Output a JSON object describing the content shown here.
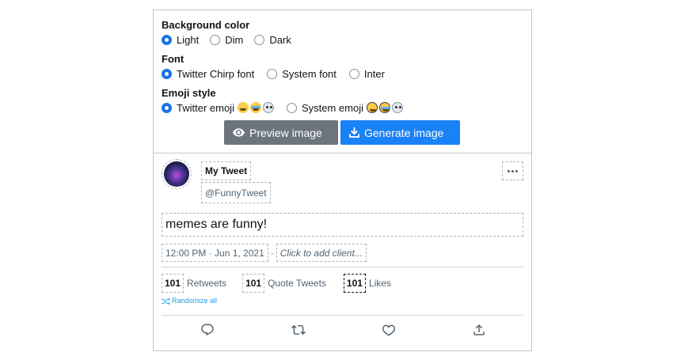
{
  "settings": {
    "background": {
      "title": "Background color",
      "options": [
        "Light",
        "Dim",
        "Dark"
      ],
      "selected": "Light"
    },
    "font": {
      "title": "Font",
      "options": [
        "Twitter Chirp font",
        "System font",
        "Inter"
      ],
      "selected": "Twitter Chirp font"
    },
    "emoji": {
      "title": "Emoji style",
      "options": [
        "Twitter emoji",
        "System emoji"
      ],
      "selected": "Twitter emoji"
    }
  },
  "buttons": {
    "preview_label": "Preview image",
    "generate_label": "Generate image"
  },
  "tweet": {
    "name": "My Tweet",
    "handle": "@FunnyTweet",
    "text": "memes are funny!",
    "time": "12:00 PM · Jun 1, 2021",
    "separator": "·",
    "client_placeholder": "Click to add client...",
    "retweets_count": "101",
    "retweets_label": "Retweets",
    "quotes_count": "101",
    "quotes_label": "Quote Tweets",
    "likes_count": "101",
    "likes_label": "Likes",
    "randomize_label": "Randomize all"
  },
  "colors": {
    "accent": "#1a82f7",
    "preview_button": "#6c757d",
    "link": "#1d9bf0"
  },
  "icons": [
    "eye-icon",
    "download-icon",
    "shuffle-icon",
    "reply-icon",
    "retweet-icon",
    "like-icon",
    "share-icon",
    "more-icon"
  ]
}
